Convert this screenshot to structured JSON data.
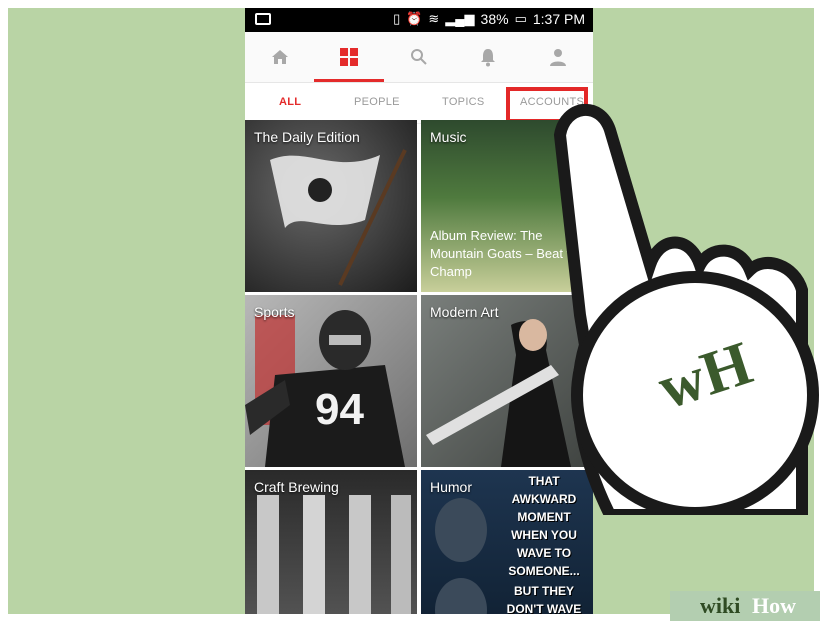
{
  "status_bar": {
    "battery": "38%",
    "time": "1:37 PM"
  },
  "nav": {
    "icons": [
      "home-icon",
      "grid-icon",
      "search-icon",
      "bell-icon",
      "profile-icon"
    ]
  },
  "tabs": {
    "all": "ALL",
    "people": "PEOPLE",
    "topics": "TOPICS",
    "accounts": "ACCOUNTS"
  },
  "tiles": {
    "daily_edition": {
      "label": "The Daily Edition"
    },
    "music": {
      "label": "Music",
      "description": "Album Review: The Mountain Goats – Beat the Champ"
    },
    "sports": {
      "label": "Sports",
      "jersey_number": "94"
    },
    "modern_art": {
      "label": "Modern Art"
    },
    "craft_brewing": {
      "label": "Craft Brewing"
    },
    "humor": {
      "label": "Humor",
      "meme_top": "THAT AWKWARD MOMENT WHEN YOU WAVE TO SOMEONE...",
      "meme_bottom": "BUT THEY DON'T WAVE"
    }
  },
  "badge": {
    "logo_text": "wH"
  },
  "watermark": {
    "part1": "wiki",
    "part2": "How"
  },
  "colors": {
    "accent": "#e42b2b",
    "background": "#b9d4a5",
    "logo_dark": "#3b5a2c",
    "logo_light": "#8bbd63"
  }
}
